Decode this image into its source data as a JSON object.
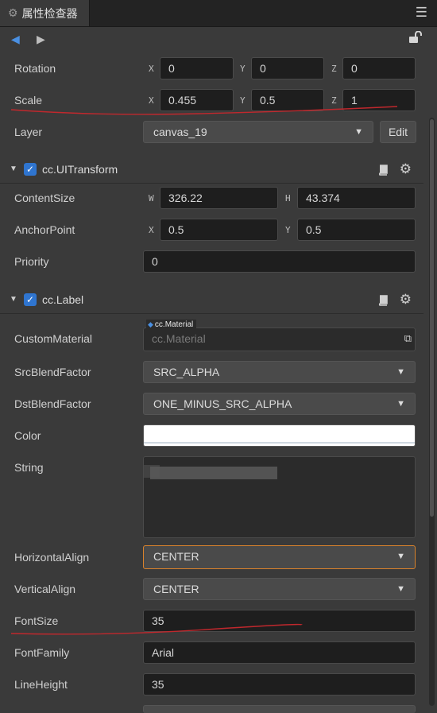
{
  "panel": {
    "title": "属性检查器"
  },
  "transform": {
    "rotation": {
      "label": "Rotation",
      "x": "0",
      "y": "0",
      "z": "0"
    },
    "scale": {
      "label": "Scale",
      "x": "0.455",
      "y": "0.5",
      "z": "1"
    },
    "layer": {
      "label": "Layer",
      "value": "canvas_19",
      "edit_label": "Edit"
    },
    "axes": {
      "x": "X",
      "y": "Y",
      "z": "Z",
      "w": "W",
      "h": "H"
    }
  },
  "ui_transform": {
    "title": "cc.UITransform",
    "content_size": {
      "label": "ContentSize",
      "w": "326.22",
      "h": "43.374"
    },
    "anchor_point": {
      "label": "AnchorPoint",
      "x": "0.5",
      "y": "0.5"
    },
    "priority": {
      "label": "Priority",
      "value": "0"
    }
  },
  "label": {
    "title": "cc.Label",
    "custom_material": {
      "label": "CustomMaterial",
      "tag": "cc.Material",
      "placeholder": "cc.Material"
    },
    "src_blend": {
      "label": "SrcBlendFactor",
      "value": "SRC_ALPHA"
    },
    "dst_blend": {
      "label": "DstBlendFactor",
      "value": "ONE_MINUS_SRC_ALPHA"
    },
    "color": {
      "label": "Color",
      "value": "#ffffff"
    },
    "string": {
      "label": "String"
    },
    "horizontal_align": {
      "label": "HorizontalAlign",
      "value": "CENTER"
    },
    "vertical_align": {
      "label": "VerticalAlign",
      "value": "CENTER"
    },
    "font_size": {
      "label": "FontSize",
      "value": "35"
    },
    "font_family": {
      "label": "FontFamily",
      "value": "Arial"
    },
    "line_height": {
      "label": "LineHeight",
      "value": "35"
    }
  },
  "colors": {
    "accent": "#2f75d0",
    "focus": "#d9822b",
    "annotation": "#c0282d"
  }
}
